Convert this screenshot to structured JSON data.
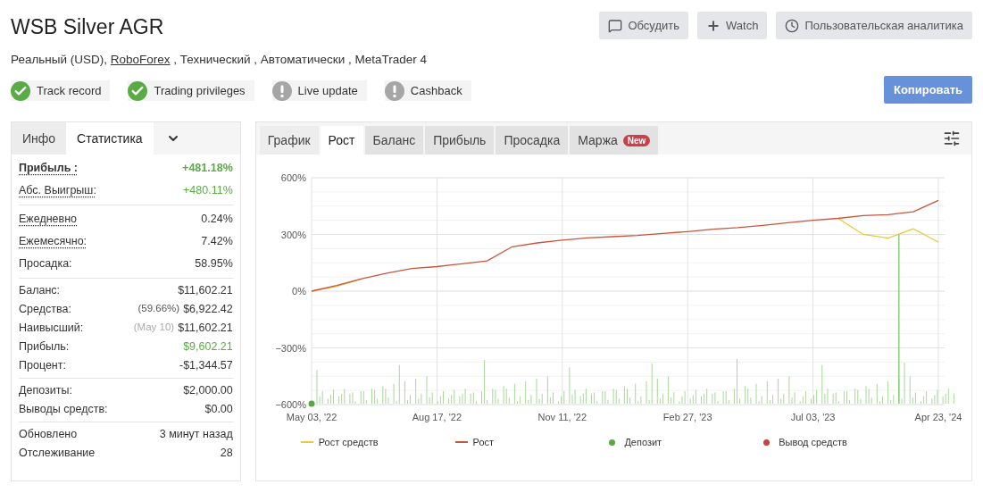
{
  "title": "WSB Silver AGR",
  "subtitle": {
    "before": "Реальный (USD),",
    "link": "RoboForex",
    "after": ", Технический , Автоматически , MetaTrader 4"
  },
  "actions": [
    {
      "label": "Обсудить"
    },
    {
      "label": "Watch"
    },
    {
      "label": "Пользовательская аналитика"
    }
  ],
  "badges": [
    {
      "label": "Track record",
      "verified": true
    },
    {
      "label": "Trading privileges",
      "verified": true
    },
    {
      "label": "Live update",
      "verified": false
    },
    {
      "label": "Cashback",
      "verified": false
    }
  ],
  "copy_button": "Копировать",
  "stats": {
    "tabs": [
      {
        "label": "Инфо",
        "selected": false
      },
      {
        "label": "Статистика",
        "selected": true
      }
    ],
    "groups": [
      [
        {
          "label": "Прибыль :",
          "value": "+481.18%",
          "bold": true,
          "dotted": true,
          "positive": true
        },
        {
          "label": "Абс. Выигрыш:",
          "value": "+480.11%",
          "bold": false,
          "dotted": true,
          "positive": true
        }
      ],
      [
        {
          "label": "Ежедневно",
          "value": "0.24%",
          "bold": false,
          "dotted": true,
          "positive": false
        },
        {
          "label": "Ежемесячно:",
          "value": "7.42%",
          "bold": false,
          "dotted": true,
          "positive": false
        },
        {
          "label": "Просадка:",
          "value": "58.95%",
          "bold": false,
          "dotted": false,
          "positive": false
        }
      ],
      [
        {
          "label": "Баланс:",
          "value": "$11,602.21",
          "bold": false,
          "dotted": false,
          "positive": false
        },
        {
          "label": "Средства:",
          "note": "(59.66%)",
          "value": "$6,922.42",
          "bold": false,
          "dotted": false,
          "positive": false
        },
        {
          "label": "Наивысший:",
          "note": "(May 10)",
          "value": "$11,602.21",
          "bold": false,
          "dotted": false,
          "positive": false
        },
        {
          "label": "Прибыль:",
          "value": "$9,602.21",
          "bold": false,
          "dotted": false,
          "positive": true
        },
        {
          "label": "Процент:",
          "value": "-$1,344.57",
          "bold": false,
          "dotted": false,
          "positive": false
        }
      ],
      [
        {
          "label": "Депозиты:",
          "value": "$2,000.00",
          "bold": false,
          "dotted": false,
          "positive": false
        },
        {
          "label": "Выводы средств:",
          "value": "$0.00",
          "bold": false,
          "dotted": false,
          "positive": false
        }
      ],
      [
        {
          "label": "Обновлено",
          "value": "3 минут назад",
          "bold": false,
          "dotted": false,
          "positive": false
        },
        {
          "label": "Отслеживание",
          "value": "28",
          "bold": false,
          "dotted": false,
          "positive": false
        }
      ]
    ]
  },
  "chart_panel": {
    "tabs": [
      {
        "label": "График",
        "selected": false,
        "kind": "plain"
      },
      {
        "label": "Рост",
        "selected": true,
        "kind": "filled"
      },
      {
        "label": "Баланс",
        "selected": false,
        "kind": "filled"
      },
      {
        "label": "Прибыль",
        "selected": false,
        "kind": "filled"
      },
      {
        "label": "Просадка",
        "selected": false,
        "kind": "filled"
      },
      {
        "label": "Маржа",
        "selected": false,
        "kind": "filled",
        "badge": "New"
      }
    ],
    "chart_data": {
      "type": "line",
      "ylim": [
        -600,
        600
      ],
      "grid": true,
      "legend": true,
      "categories": [
        "May 03, '22",
        null,
        null,
        null,
        null,
        "Aug 17, '22",
        null,
        null,
        null,
        null,
        "Nov 11, '22",
        null,
        null,
        null,
        null,
        "Feb 27, '23",
        null,
        null,
        null,
        null,
        "Jul 03, '23",
        null,
        null,
        null,
        null,
        "Apr 23, '24"
      ],
      "yticks": [
        {
          "value": 600,
          "label": "600%"
        },
        {
          "value": 300,
          "label": "300%"
        },
        {
          "value": 0,
          "label": "0%"
        },
        {
          "value": -300,
          "label": "−300%"
        },
        {
          "value": -600,
          "label": "−600%"
        }
      ],
      "series": [
        {
          "name": "Рост средств",
          "color": "#e8c93a",
          "values": [
            0,
            25,
            65,
            null,
            null,
            null,
            null,
            null,
            null,
            null,
            null,
            null,
            null,
            null,
            null,
            null,
            null,
            null,
            null,
            null,
            null,
            385,
            300,
            280,
            330,
            260
          ]
        },
        {
          "name": "Рост",
          "color": "#c8553d",
          "values": [
            0,
            30,
            65,
            95,
            120,
            130,
            145,
            160,
            235,
            255,
            270,
            282,
            288,
            295,
            305,
            315,
            328,
            336,
            348,
            362,
            375,
            385,
            400,
            405,
            420,
            480
          ]
        }
      ]
    },
    "markers": [
      {
        "name": "Депозит",
        "color": "#5aa845"
      },
      {
        "name": "Вывод средств",
        "color": "#c94040"
      }
    ]
  }
}
